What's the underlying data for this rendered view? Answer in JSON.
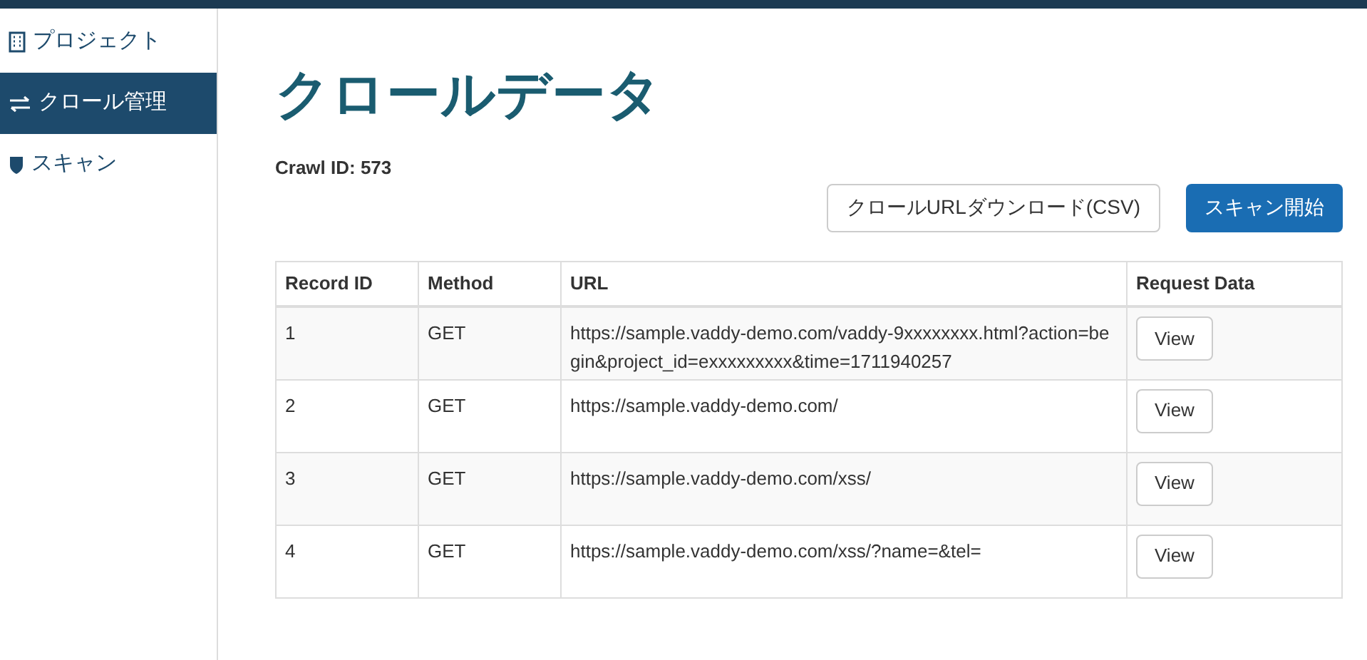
{
  "sidebar": {
    "items": [
      {
        "label": "プロジェクト",
        "selected": false
      },
      {
        "label": "クロール管理",
        "selected": true
      },
      {
        "label": "スキャン",
        "selected": false
      }
    ]
  },
  "title": "クロールデータ",
  "crawl_id": "Crawl ID: 573",
  "buttons": [
    {
      "label": "クロールURLダウンロード(CSV)",
      "kind": "default"
    },
    {
      "label": "スキャン開始",
      "kind": "primary"
    }
  ],
  "table": {
    "columns": [
      "Record ID",
      "Method",
      "URL",
      "Request Data"
    ],
    "rows": [
      {
        "id": "1",
        "method": "GET",
        "url": "https://sample.vaddy-demo.com/vaddy-9xxxxxxxx.html?action=begin&project_id=exxxxxxxxx&time=1711940257",
        "action": "View"
      },
      {
        "id": "2",
        "method": "GET",
        "url": "https://sample.vaddy-demo.com/",
        "action": "View"
      },
      {
        "id": "3",
        "method": "GET",
        "url": "https://sample.vaddy-demo.com/xss/",
        "action": "View"
      },
      {
        "id": "4",
        "method": "GET",
        "url": "https://sample.vaddy-demo.com/xss/?name=&tel=",
        "action": "View"
      }
    ]
  }
}
